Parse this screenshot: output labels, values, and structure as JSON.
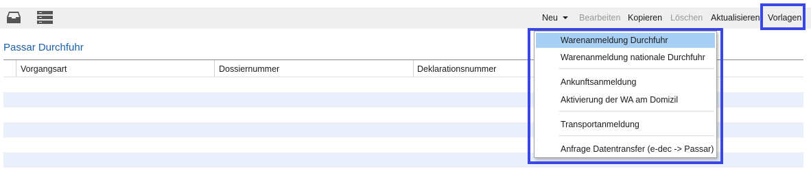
{
  "toolbar": {
    "icons": [
      "inbox-icon",
      "list-icon"
    ],
    "neu": "Neu",
    "bearbeiten": "Bearbeiten",
    "kopieren": "Kopieren",
    "loeschen": "Löschen",
    "aktualisieren": "Aktualisieren",
    "vorlagen": "Vorlagen"
  },
  "page_title": "Passar Durchfuhr",
  "grid": {
    "columns": [
      "Vorgangsart",
      "Dossiernummer",
      "Deklarationsnummer"
    ],
    "row_colors": {
      "odd": "#ffffff",
      "even": "#eaf0fb"
    }
  },
  "dropdown": {
    "items": [
      "Warenanmeldung Durchfuhr",
      "Warenanmeldung nationale Durchfuhr",
      "Ankunftsanmeldung",
      "Aktivierung der WA am Domizil",
      "Transportanmeldung",
      "Anfrage Datentransfer (e-dec -> Passar)"
    ],
    "selected": "Warenanmeldung Durchfuhr"
  },
  "colors": {
    "highlight_frame": "#3b46e6",
    "title": "#1b5fa8",
    "selection": "#a8d0f5",
    "toolbar_bg": "#efefef"
  }
}
